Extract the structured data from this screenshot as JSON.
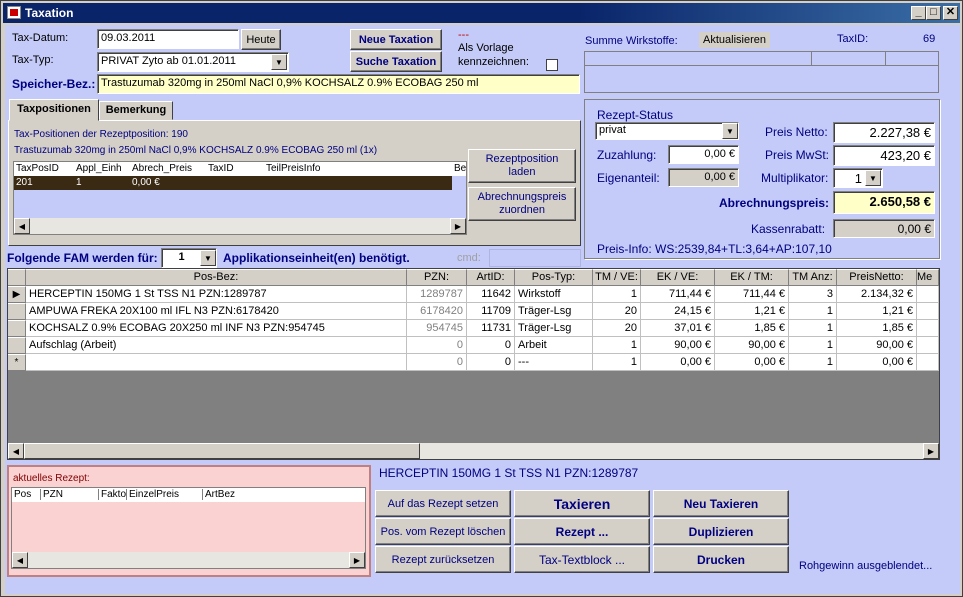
{
  "window": {
    "title": "Taxation",
    "min": "_",
    "max": "□",
    "close": "✕"
  },
  "header": {
    "tax_datum_label": "Tax-Datum:",
    "tax_datum_value": "09.03.2011",
    "heute_button": "Heute",
    "tax_typ_label": "Tax-Typ:",
    "tax_typ_value": "PRIVAT Zyto ab 01.01.2011",
    "neue_taxation_button": "Neue Taxation",
    "suche_taxation_button": "Suche Taxation",
    "dashes": "---",
    "vorlage_label_1": "Als Vorlage",
    "vorlage_label_2": "kennzeichnen:",
    "speicher_label": "Speicher-Bez.:",
    "speicher_value": "Trastuzumab 320mg in 250ml NaCl 0,9% KOCHSALZ 0.9% ECOBAG 250 ml",
    "summe_label": "Summe Wirkstoffe:",
    "aktualisieren_label": "Aktualisieren",
    "taxid_label": "TaxID:",
    "taxid_value": "69"
  },
  "tabs": [
    {
      "label": "Taxpositionen"
    },
    {
      "label": "Bemerkung"
    }
  ],
  "taxpos": {
    "info_line1": "Tax-Positionen der Rezeptposition: 190",
    "info_line2": "Trastuzumab 320mg in 250ml NaCl 0,9% KOCHSALZ 0.9% ECOBAG 250 ml (1x)",
    "columns": [
      "TaxPosID",
      "Appl_Einh",
      "Abrech_Preis",
      "TaxID",
      "TeilPreisInfo",
      "Be"
    ],
    "row": [
      "201",
      "1",
      "0,00 €",
      "",
      ""
    ],
    "rezeptpos_button_1": "Rezeptposition",
    "rezeptpos_button_2": "laden",
    "abrechnung_button_1": "Abrechnungspreis",
    "abrechnung_button_2": "zuordnen"
  },
  "rezept": {
    "status_label": "Rezept-Status",
    "status_value": "privat",
    "zuzahlung_label": "Zuzahlung:",
    "zuzahlung_value": "0,00 €",
    "eigenanteil_label": "Eigenanteil:",
    "eigenanteil_value": "0,00 €",
    "preis_netto_label": "Preis Netto:",
    "preis_netto_value": "2.227,38 €",
    "preis_mwst_label": "Preis MwSt:",
    "preis_mwst_value": "423,20 €",
    "multiplikator_label": "Multiplikator:",
    "multiplikator_value": "1",
    "abrechnungspreis_label": "Abrechnungspreis:",
    "abrechnungspreis_value": "2.650,58 €",
    "kassenrabatt_label": "Kassenrabatt:",
    "kassenrabatt_value": "0,00 €",
    "preis_info": "Preis-Info: WS:2539,84+TL:3,64+AP:107,10"
  },
  "fam": {
    "label": "Folgende FAM werden für:",
    "value": "1",
    "suffix": "Applikationseinheit(en) benötigt.",
    "cmd_label": "cmd:"
  },
  "positions": {
    "columns": [
      "Pos-Bez:",
      "PZN:",
      "ArtID:",
      "Pos-Typ:",
      "TM / VE:",
      "EK / VE:",
      "EK / TM:",
      "TM Anz:",
      "PreisNetto:",
      "Me"
    ],
    "rows": [
      [
        "HERCEPTIN 150MG   1 St TSS N1 PZN:1289787",
        "1289787",
        "11642",
        "Wirkstoff",
        "1",
        "711,44 €",
        "711,44 €",
        "3",
        "2.134,32 €"
      ],
      [
        "AMPUWA FREKA   20X100 ml IFL N3 PZN:6178420",
        "6178420",
        "11709",
        "Träger-Lsg",
        "20",
        "24,15 €",
        "1,21 €",
        "1",
        "1,21 €"
      ],
      [
        "KOCHSALZ 0.9% ECOBAG   20X250 ml INF N3 PZN:954745",
        "954745",
        "11731",
        "Träger-Lsg",
        "20",
        "37,01 €",
        "1,85 €",
        "1",
        "1,85 €"
      ],
      [
        "Aufschlag (Arbeit)",
        "0",
        "0",
        "Arbeit",
        "1",
        "90,00 €",
        "90,00 €",
        "1",
        "90,00 €"
      ],
      [
        "",
        "0",
        "0",
        "---",
        "1",
        "0,00 €",
        "0,00 €",
        "1",
        "0,00 €"
      ]
    ],
    "row_indicators": [
      "▶",
      "",
      "",
      "",
      "*"
    ]
  },
  "aktuelles_rezept": {
    "label": "aktuelles Rezept:",
    "columns": [
      "Pos",
      "PZN",
      "Fakto",
      "EinzelPreis",
      "ArtBez"
    ]
  },
  "selected_item": "HERCEPTIN 150MG   1 St TSS N1 PZN:1289787",
  "buttons": {
    "auf_rezept": "Auf das Rezept setzen",
    "pos_loeschen": "Pos. vom Rezept löschen",
    "zuruecksetzen": "Rezept zurücksetzen",
    "taxieren": "Taxieren",
    "rezept": "Rezept ...",
    "textblock": "Tax-Textblock ...",
    "neu_taxieren": "Neu Taxieren",
    "duplizieren": "Duplizieren",
    "drucken": "Drucken"
  },
  "rohgewinn": "Rohgewinn ausgeblendet..."
}
